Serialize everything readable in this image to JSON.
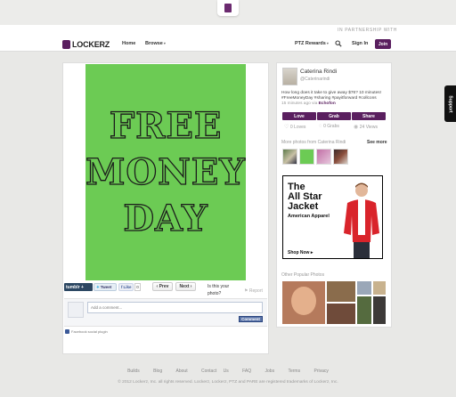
{
  "colors": {
    "brand": "#5a1f5f",
    "photo_green": "#6ccb54",
    "facebook": "#3b5998"
  },
  "topbar": {
    "search_hint": "IN PARTNERSHIP WITH"
  },
  "nav": {
    "brand": "LOCKERZ",
    "home": "Home",
    "browse": "Browse",
    "rewards": "PTZ Rewards",
    "signin": "Sign In",
    "join": "Join",
    "icons": [
      "search-icon",
      "chevron-down-icon"
    ]
  },
  "photo": {
    "lines": [
      "FREE",
      "MONEY",
      "DAY"
    ]
  },
  "share": {
    "tumblr": "tumblr +",
    "tweet": "Tweet",
    "like": "Like",
    "like_count": "0",
    "prev": "‹ Prev",
    "next": "Next ›",
    "owner_q": "Is this your photo?",
    "report": "Report"
  },
  "comments": {
    "placeholder": "Add a comment...",
    "button": "Comment",
    "plugin": "Facebook social plugin"
  },
  "sidebar": {
    "user_name": "Caterina Rindi",
    "user_handle": "@Caterinarindi",
    "caption": "How long does it take to give away $76? 10 minutes! #FreeMoneyDay #sharing #payitforward #collcons",
    "time": "15 minutes ago via",
    "via": "Echofon",
    "actions": [
      "Love",
      "Grab",
      "Share"
    ],
    "stats": {
      "loves": "0 Loves",
      "grabs": "0 Grabs",
      "views": "24 Views"
    },
    "more_head": "More photos from Caterina Rindi",
    "see_more": "See more",
    "popular_head": "Other Popular Photos"
  },
  "ad": {
    "line1": "The",
    "line2": "All Star",
    "line3": "Jacket",
    "brand": "American Apparel",
    "cta": "Shop Now ▸"
  },
  "footer": {
    "links": [
      "Builds",
      "Blog",
      "About",
      "Contact Us",
      "FAQ",
      "Jobs",
      "Terms",
      "Privacy"
    ],
    "copyright": "© 2012 Lockerz, Inc. all rights reserved. Lockerz, Lockerz, PTZ and PARE are registered trademarks of Lockerz, Inc."
  },
  "support": "Support"
}
